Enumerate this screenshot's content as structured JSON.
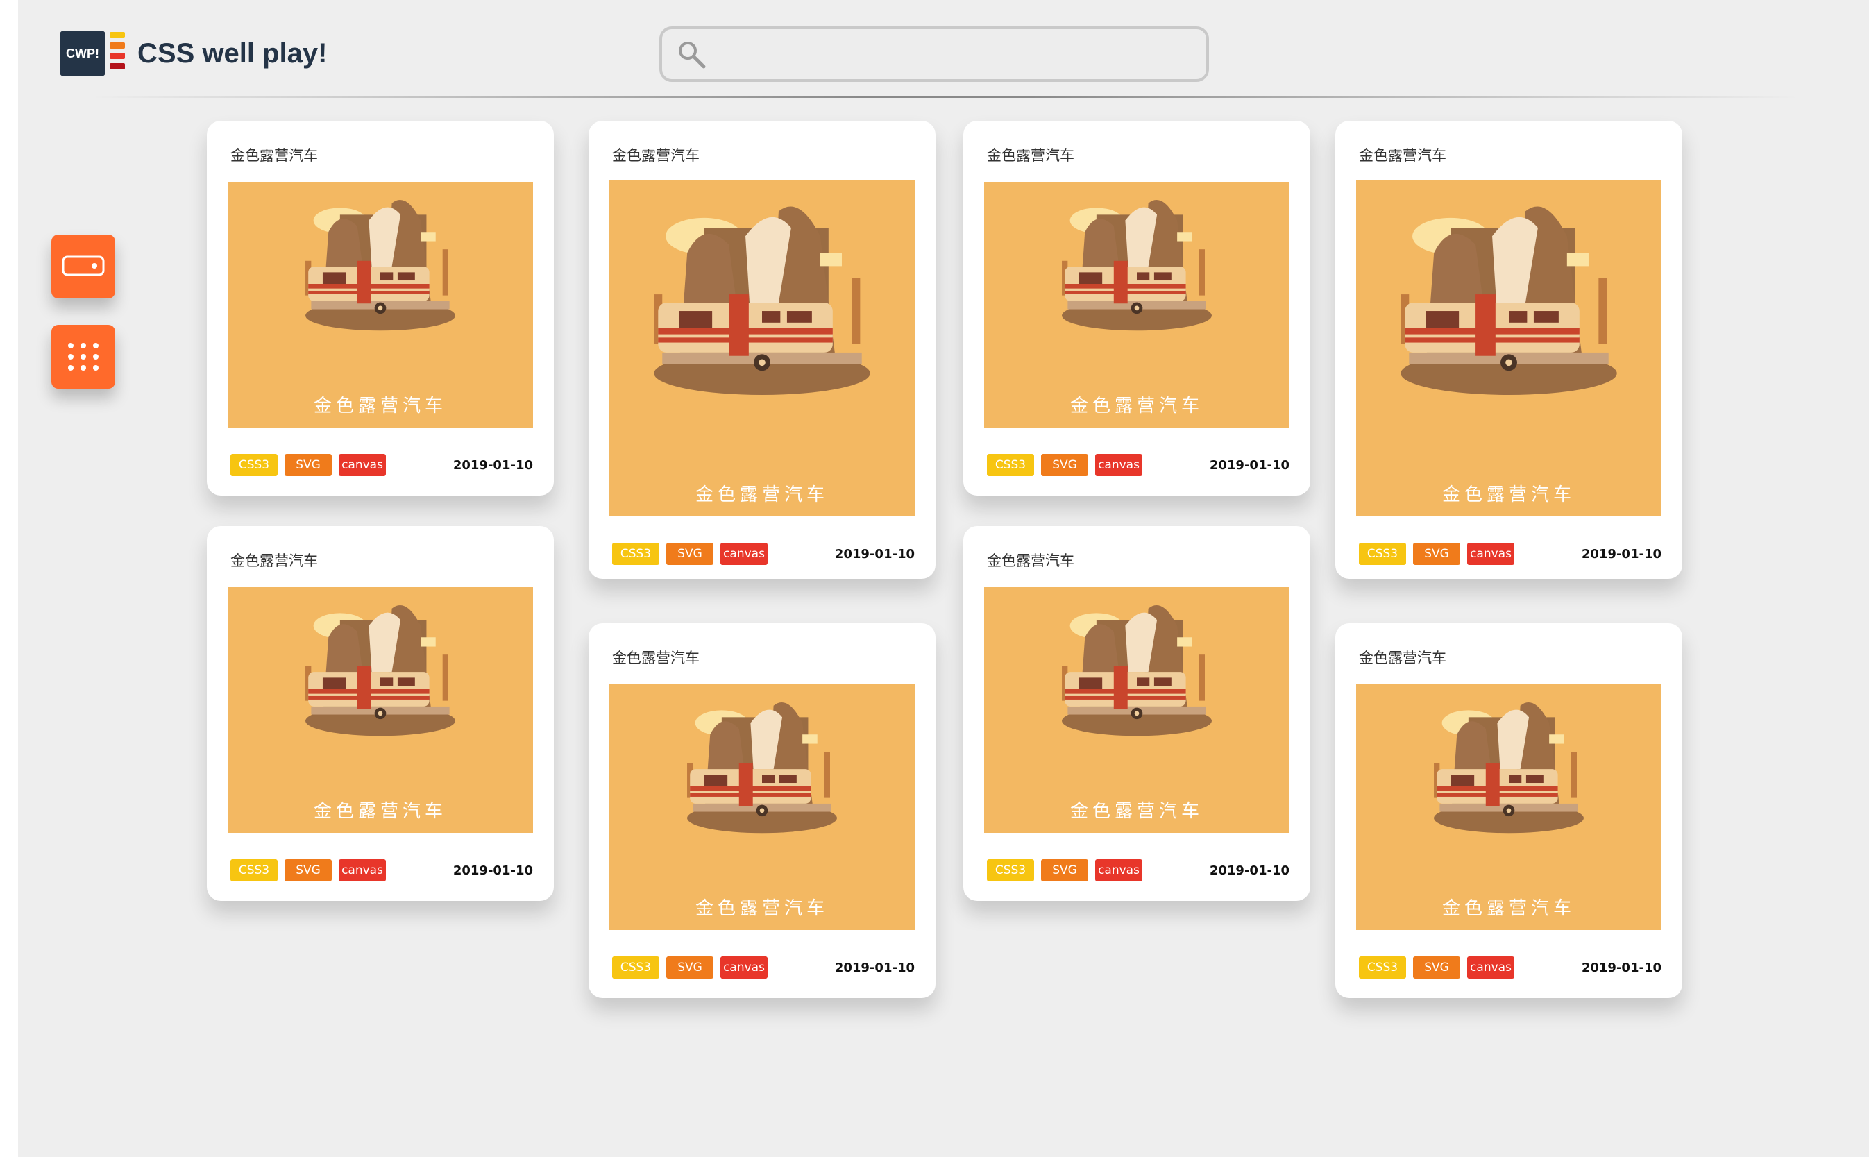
{
  "header": {
    "logo_text": "CWP!",
    "logo_bar_colors": [
      "#f7c511",
      "#f07b1b",
      "#e8362a",
      "#d11f24",
      "#b3121a"
    ],
    "title": "CSS well play!",
    "search_placeholder": ""
  },
  "sidebar": {
    "buttons": [
      {
        "icon": "toggle-icon"
      },
      {
        "icon": "grid-dots-icon"
      }
    ],
    "accent": "#ff6a2b"
  },
  "cards": [
    {
      "title": "金色露营汽车",
      "caption": "金色露营汽车",
      "tags": [
        "CSS3",
        "SVG",
        "canvas"
      ],
      "date": "2019-01-10"
    },
    {
      "title": "金色露营汽车",
      "caption": "金色露营汽车",
      "tags": [
        "CSS3",
        "SVG",
        "canvas"
      ],
      "date": "2019-01-10"
    },
    {
      "title": "金色露营汽车",
      "caption": "金色露营汽车",
      "tags": [
        "CSS3",
        "SVG",
        "canvas"
      ],
      "date": "2019-01-10"
    },
    {
      "title": "金色露营汽车",
      "caption": "金色露营汽车",
      "tags": [
        "CSS3",
        "SVG",
        "canvas"
      ],
      "date": "2019-01-10"
    },
    {
      "title": "金色露营汽车",
      "caption": "金色露营汽车",
      "tags": [
        "CSS3",
        "SVG",
        "canvas"
      ],
      "date": "2019-01-10"
    },
    {
      "title": "金色露营汽车",
      "caption": "金色露营汽车",
      "tags": [
        "CSS3",
        "SVG",
        "canvas"
      ],
      "date": "2019-01-10"
    },
    {
      "title": "金色露营汽车",
      "caption": "金色露营汽车",
      "tags": [
        "CSS3",
        "SVG",
        "canvas"
      ],
      "date": "2019-01-10"
    },
    {
      "title": "金色露营汽车",
      "caption": "金色露营汽车",
      "tags": [
        "CSS3",
        "SVG",
        "canvas"
      ],
      "date": "2019-01-10"
    }
  ],
  "colors": {
    "thumb_bg": "#f3b862",
    "tag_css3": "#f7c511",
    "tag_svg": "#f07b1b",
    "tag_canvas": "#e8362a"
  }
}
